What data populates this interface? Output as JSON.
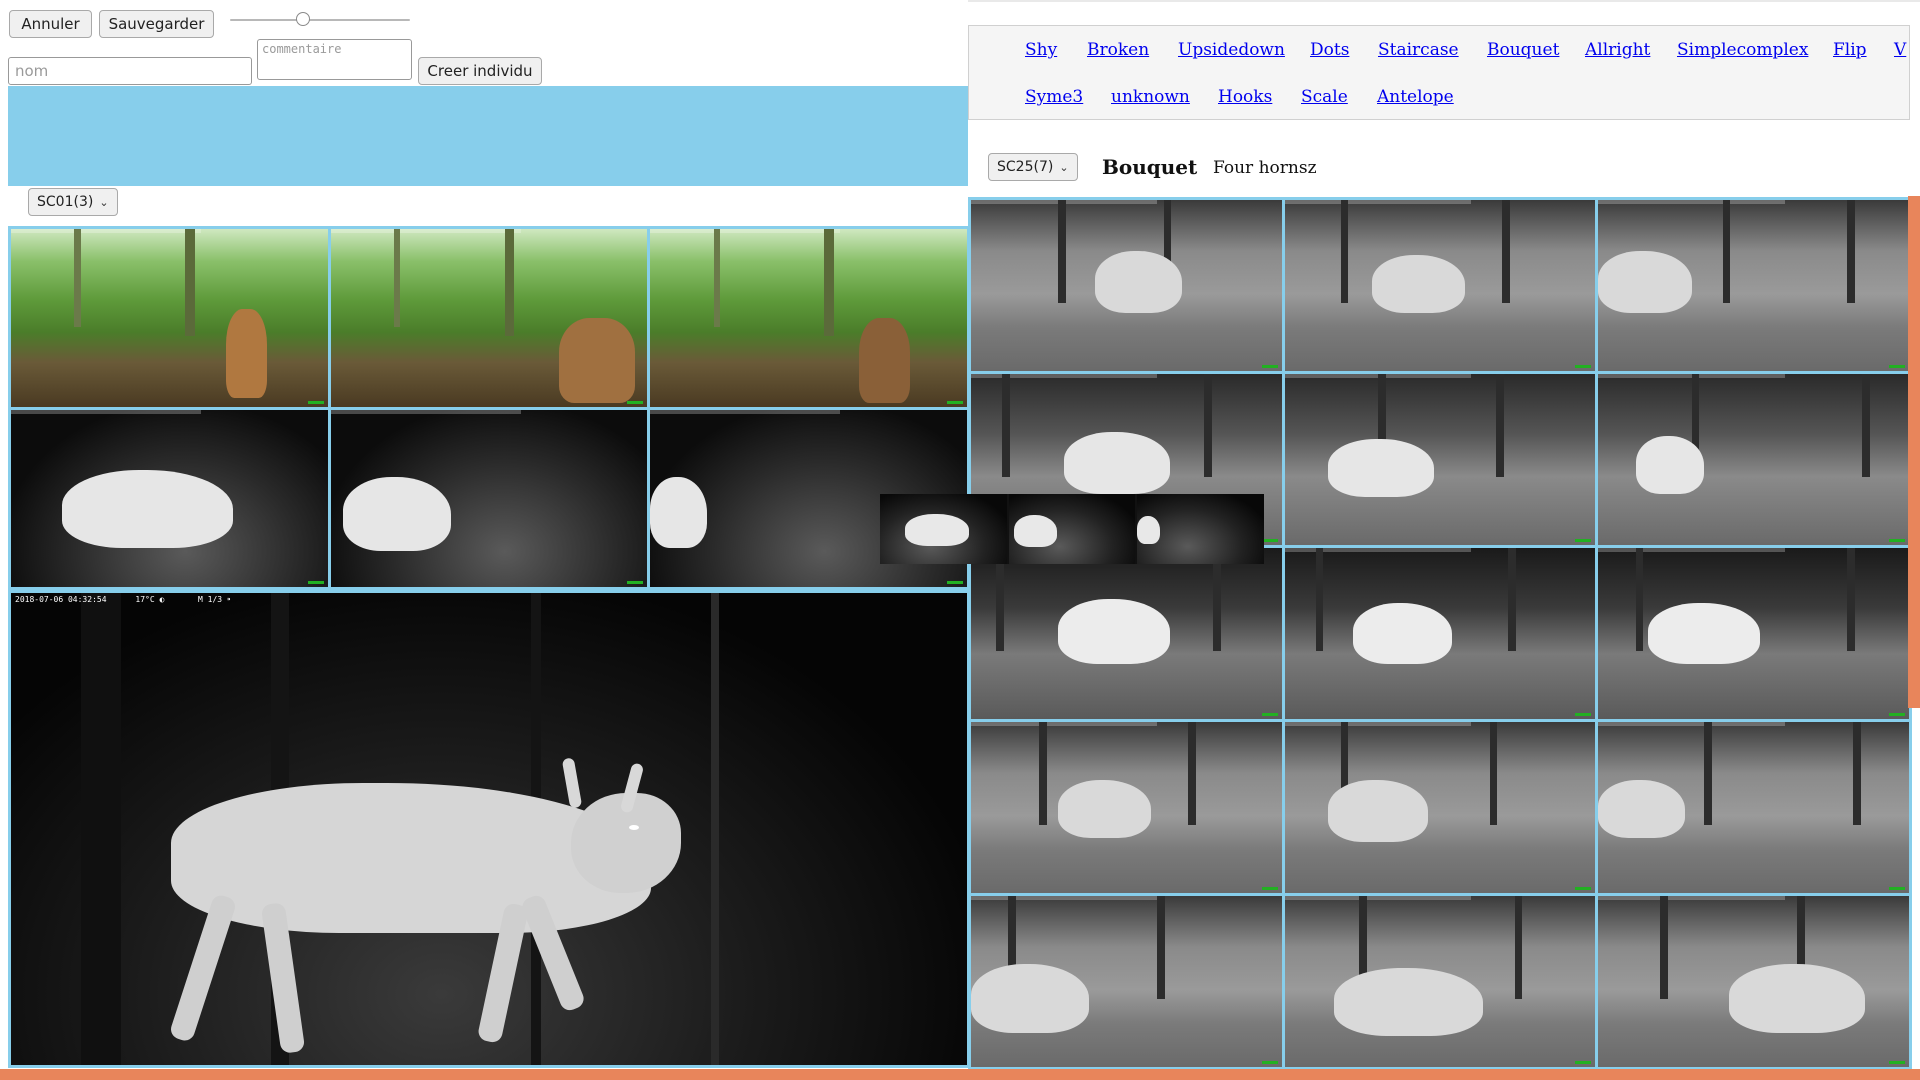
{
  "toolbar": {
    "cancel_label": "Annuler",
    "save_label": "Sauvegarder",
    "slider_value": 0.4
  },
  "form": {
    "name_placeholder": "nom",
    "comment_placeholder": "commentaire",
    "create_label": "Creer individu"
  },
  "left": {
    "sequence_select": "SC01(3)",
    "big_view_meta": "2018-07-06 04:32:54      17°C ◐       M 1/3 ⁍"
  },
  "right": {
    "individuals": [
      "Shy",
      "Broken",
      "Upsidedown",
      "Dots",
      "Staircase",
      "Bouquet",
      "Allright",
      "Simplecomplex",
      "Flip",
      "V",
      "Syme3",
      "unknown",
      "Hooks",
      "Scale",
      "Antelope"
    ],
    "sequence_select": "SC25(7)",
    "selected_name": "Bouquet",
    "selected_comment": "Four hornsz"
  },
  "colors": {
    "accent_blue": "#87ceeb",
    "accent_orange": "#e8855b",
    "link": "#0000ee"
  },
  "icons": {
    "select_chevron": "chevron-down-icon"
  }
}
